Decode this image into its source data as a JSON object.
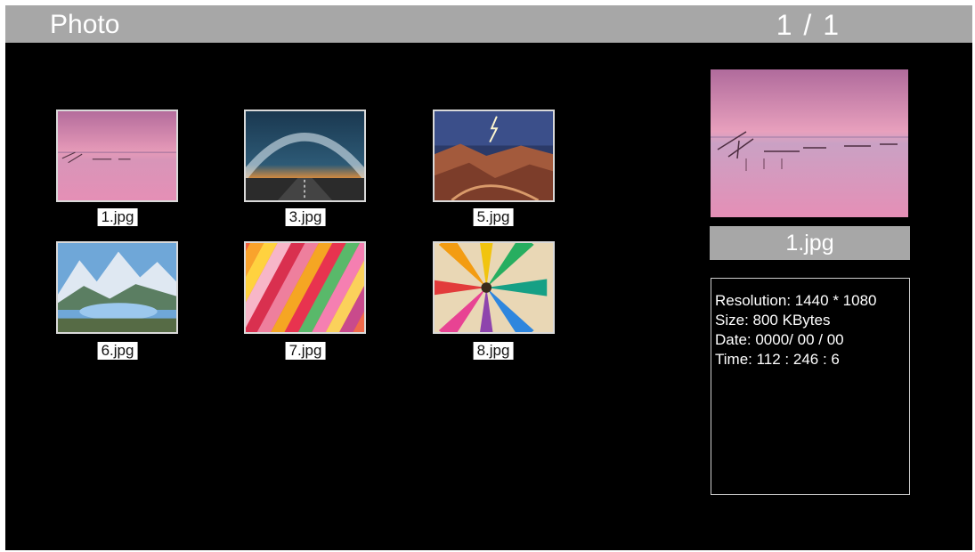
{
  "header": {
    "title": "Photo",
    "page_indicator": "1 / 1"
  },
  "thumbnails": [
    {
      "label": "1.jpg",
      "scene": "pink-lake"
    },
    {
      "label": "3.jpg",
      "scene": "milky-way-road"
    },
    {
      "label": "5.jpg",
      "scene": "canyon-lightning"
    },
    {
      "label": "6.jpg",
      "scene": "mountain-lake"
    },
    {
      "label": "7.jpg",
      "scene": "colored-pencils-diagonal"
    },
    {
      "label": "8.jpg",
      "scene": "colored-pencils-spiral"
    }
  ],
  "preview": {
    "filename": "1.jpg",
    "info": {
      "resolution": "Resolution: 1440 * 1080",
      "size": "Size: 800 KBytes",
      "date": "Date: 0000/ 00 / 00",
      "time": "Time: 112 : 246 : 6"
    }
  },
  "colors": {
    "header_bar": "#a7a7a7",
    "background": "#000000"
  }
}
